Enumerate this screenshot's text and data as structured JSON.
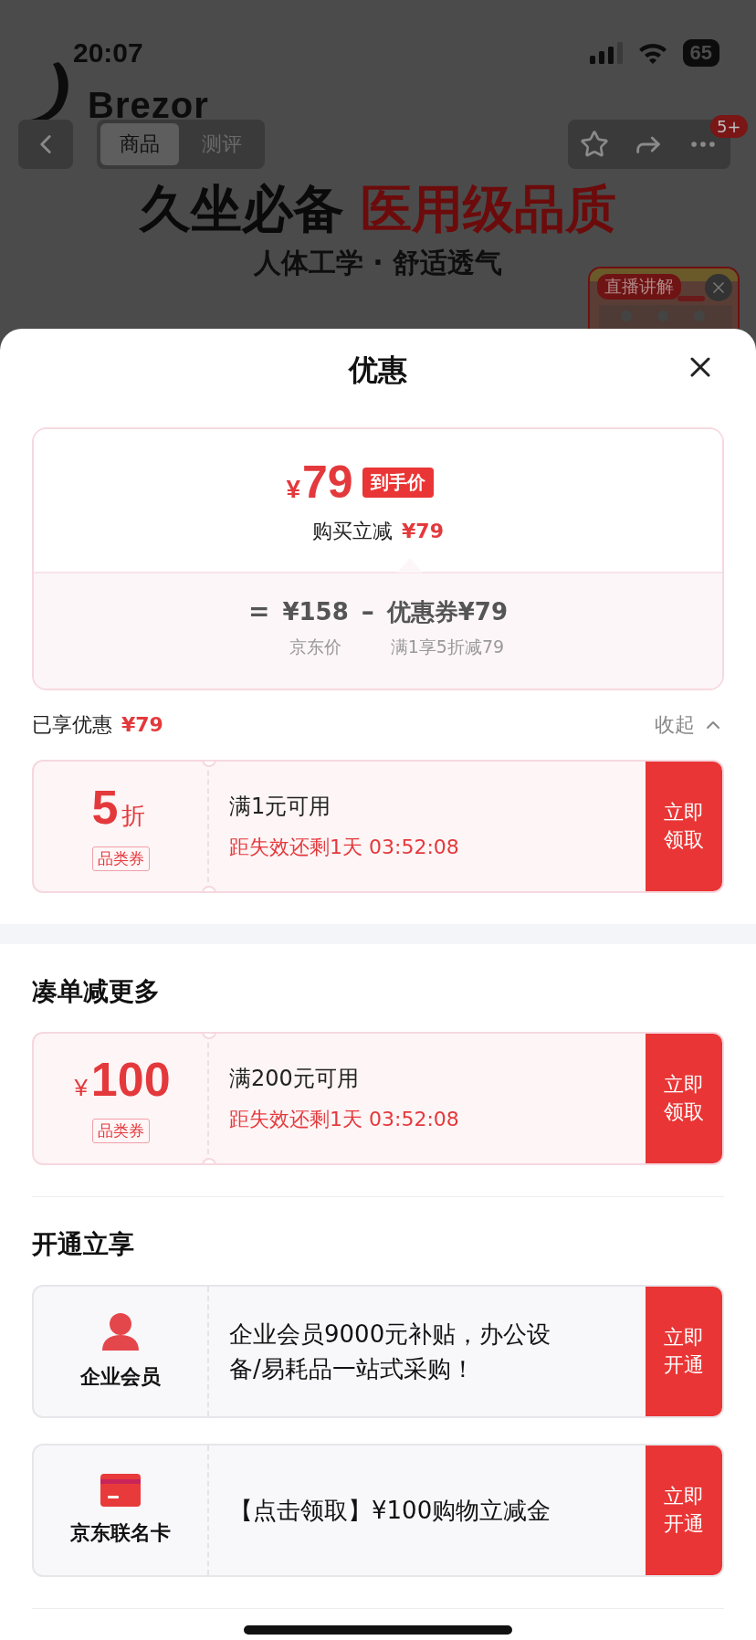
{
  "status_bar": {
    "time": "20:07",
    "battery": "65"
  },
  "header": {
    "logo": "Brezor",
    "tabs": [
      {
        "label": "商品",
        "selected": true
      },
      {
        "label": "测评",
        "selected": false
      }
    ],
    "badge": "5+"
  },
  "banner": {
    "headline": "久坐必备",
    "headline_accent": "医用级品质",
    "subtitle": "人体工学 · 舒适透气",
    "live_label": "直播讲解"
  },
  "sheet": {
    "title": "优惠",
    "price_card": {
      "currency": "¥",
      "amount": "79",
      "tag": "到手价",
      "saving_label": "购买立减",
      "saving_value": "¥79",
      "formula": [
        {
          "op": "=",
          "value": "¥158",
          "caption": "京东价"
        },
        {
          "op": "–",
          "value": "优惠券¥79",
          "caption": "满1享5折减79"
        }
      ]
    },
    "enjoyed": {
      "label": "已享优惠",
      "value": "¥79",
      "toggle": "收起",
      "expanded": true
    },
    "coupons": [
      {
        "kind": "discount",
        "amount": "5",
        "unit": "折",
        "tag": "品类券",
        "condition": "满1元可用",
        "countdown": "距失效还剩1天 03:52:08",
        "action": "立即领取"
      }
    ],
    "sections": [
      {
        "title": "凑单减更多",
        "coupons": [
          {
            "kind": "cash",
            "amount": "100",
            "unit": "¥",
            "tag": "品类券",
            "condition": "满200元可用",
            "countdown": "距失效还剩1天 03:52:08",
            "action": "立即领取"
          }
        ]
      },
      {
        "title": "开通立享",
        "offers": [
          {
            "kind": "member",
            "name": "企业会员",
            "description": "企业会员9000元补贴，办公设备/易耗品一站式采购！",
            "action": "立即开通"
          },
          {
            "kind": "card",
            "name": "京东联名卡",
            "description": "【点击领取】¥100购物立减金",
            "action": "立即开通"
          }
        ]
      }
    ]
  }
}
